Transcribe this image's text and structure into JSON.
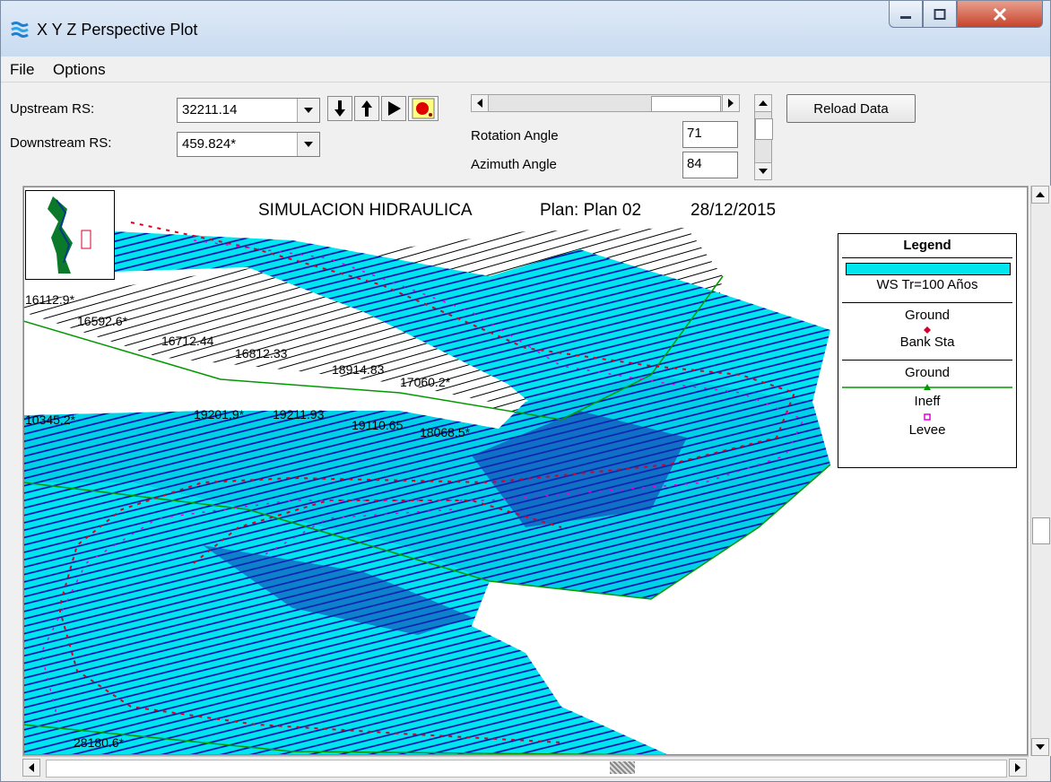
{
  "window": {
    "title": "X Y Z Perspective Plot"
  },
  "menu": {
    "items": [
      "File",
      "Options"
    ]
  },
  "controls": {
    "upstream_label": "Upstream RS:",
    "upstream_value": "32211.14",
    "downstream_label": "Downstream RS:",
    "downstream_value": "459.824*",
    "rotation_label": "Rotation Angle",
    "rotation_value": "71",
    "azimuth_label": "Azimuth Angle",
    "azimuth_value": "84",
    "reload_label": "Reload Data"
  },
  "plot": {
    "title": "SIMULACION HIDRAULICA",
    "plan": "Plan: Plan 02",
    "date": "28/12/2015",
    "stations": [
      "16112.9*",
      "16592.6*",
      "16712.44",
      "16812.33",
      "18914.83",
      "17060.2*",
      "10345.2*",
      "19201.9*",
      "19211.93",
      "19110.65",
      "18068.5*",
      "28180.6*"
    ]
  },
  "legend": {
    "title": "Legend",
    "items": [
      "WS Tr=100 Años",
      "Ground",
      "Bank Sta",
      "Ground",
      "Ineff",
      "Levee"
    ]
  },
  "colors": {
    "water": "#00e5ee",
    "water_dark": "#00bcd9",
    "section_line": "#0000aa",
    "bank": "#d4002a",
    "levee": "#e000e0",
    "ground": "#009900"
  }
}
